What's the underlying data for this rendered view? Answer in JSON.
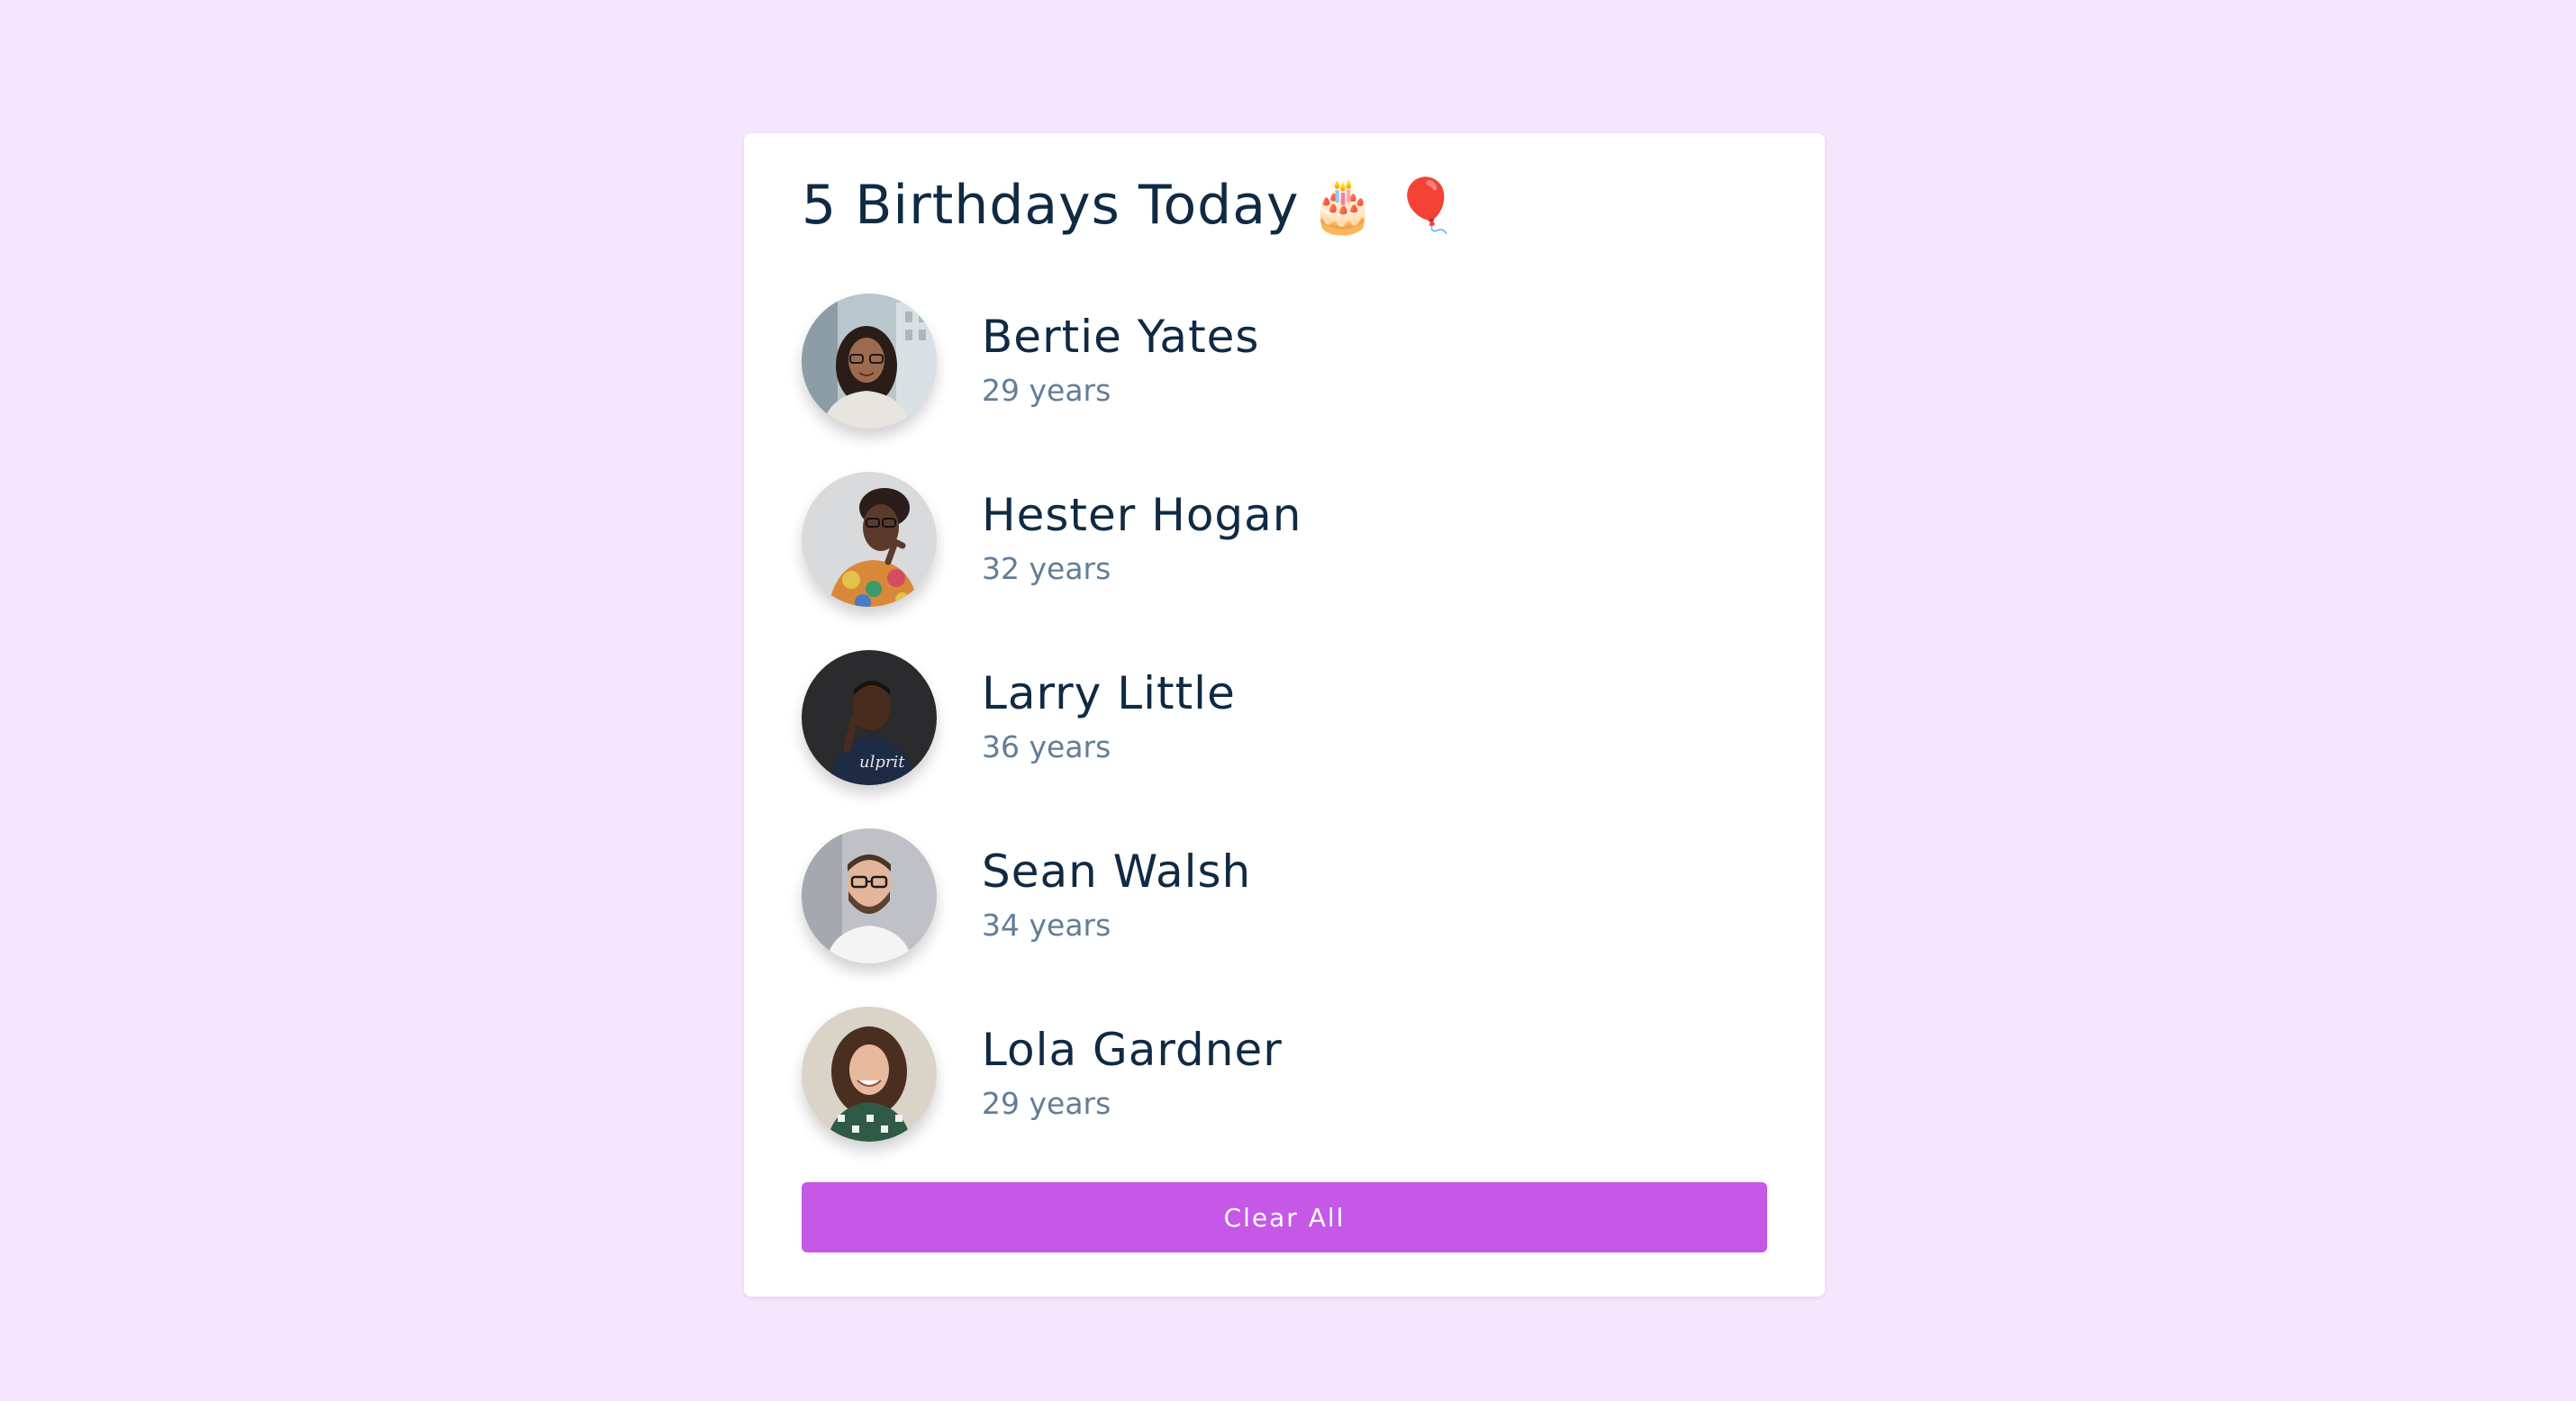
{
  "title": {
    "text": "5 Birthdays Today",
    "emojis": "🎂 🎈"
  },
  "people": [
    {
      "name": "Bertie Yates",
      "age": "29 years",
      "avatar_icon": "avatar-woman-glasses-street"
    },
    {
      "name": "Hester Hogan",
      "age": "32 years",
      "avatar_icon": "avatar-woman-glasses-floral"
    },
    {
      "name": "Larry Little",
      "age": "36 years",
      "avatar_icon": "avatar-man-dark-background"
    },
    {
      "name": "Sean Walsh",
      "age": "34 years",
      "avatar_icon": "avatar-man-glasses-beard"
    },
    {
      "name": "Lola Gardner",
      "age": "29 years",
      "avatar_icon": "avatar-woman-curly-hair"
    }
  ],
  "clear_button": {
    "label": "Clear All"
  },
  "colors": {
    "background": "#f5e6fd",
    "card": "#ffffff",
    "accent": "#c558e6",
    "heading_text": "#102a43",
    "secondary_text": "#627d98"
  }
}
